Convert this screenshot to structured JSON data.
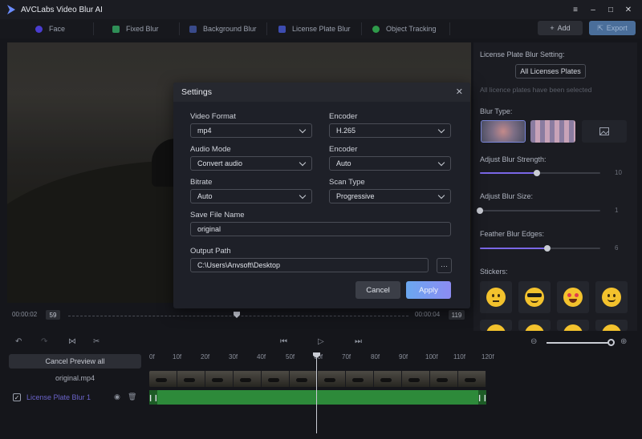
{
  "app": {
    "title": "AVCLabs Video Blur AI"
  },
  "window_controls": {
    "menu": "≡",
    "minimize": "–",
    "maximize": "□",
    "close": "✕"
  },
  "tabs": [
    {
      "label": "Face",
      "icon": "face-icon",
      "color": "#4a3dd0"
    },
    {
      "label": "Fixed Blur",
      "icon": "fixed-blur-icon",
      "color": "#2f8f57"
    },
    {
      "label": "Background Blur",
      "icon": "background-blur-icon",
      "color": "#394a8a"
    },
    {
      "label": "License Plate Blur",
      "icon": "license-plate-icon",
      "color": "#3d4cb0"
    },
    {
      "label": "Object Tracking",
      "icon": "object-tracking-icon",
      "color": "#2f9a4a"
    }
  ],
  "toolbar": {
    "add_label": "Add",
    "export_label": "Export"
  },
  "player": {
    "time_start": "00:00:02",
    "frame_start": "59",
    "time_end": "00:00:04",
    "frame_end": "119"
  },
  "right_panel": {
    "title": "License Plate Blur Setting:",
    "all_plates_button": "All Licenses Plates",
    "note": "All licence plates have been selected",
    "blur_type_label": "Blur Type:",
    "strength_label": "Adjust Blur Strength:",
    "strength_value": "10",
    "strength_fraction": 0.47,
    "size_label": "Adjust Blur Size:",
    "size_value": "1",
    "size_fraction": 0.0,
    "feather_label": "Feather Blur Edges:",
    "feather_value": "6",
    "feather_fraction": 0.56,
    "stickers_label": "Stickers:"
  },
  "timeline": {
    "cancel_preview": "Cancel Preview all",
    "source_name": "original.mp4",
    "layer_name": "License Plate Blur 1",
    "ruler": [
      "0f",
      "10f",
      "20f",
      "30f",
      "40f",
      "50f",
      "60f",
      "70f",
      "80f",
      "90f",
      "100f",
      "110f",
      "120f"
    ]
  },
  "settings": {
    "title": "Settings",
    "video_format_label": "Video Format",
    "video_format_value": "mp4",
    "encoder_label": "Encoder",
    "encoder_value": "H.265",
    "audio_mode_label": "Audio Mode",
    "audio_mode_value": "Convert audio",
    "audio_encoder_label": "Encoder",
    "audio_encoder_value": "Auto",
    "bitrate_label": "Bitrate",
    "bitrate_value": "Auto",
    "scan_type_label": "Scan Type",
    "scan_type_value": "Progressive",
    "save_name_label": "Save File Name",
    "save_name_value": "original",
    "output_path_label": "Output Path",
    "output_path_value": "C:\\Users\\Anvsoft\\Desktop",
    "browse_label": "···",
    "cancel_label": "Cancel",
    "apply_label": "Apply"
  }
}
